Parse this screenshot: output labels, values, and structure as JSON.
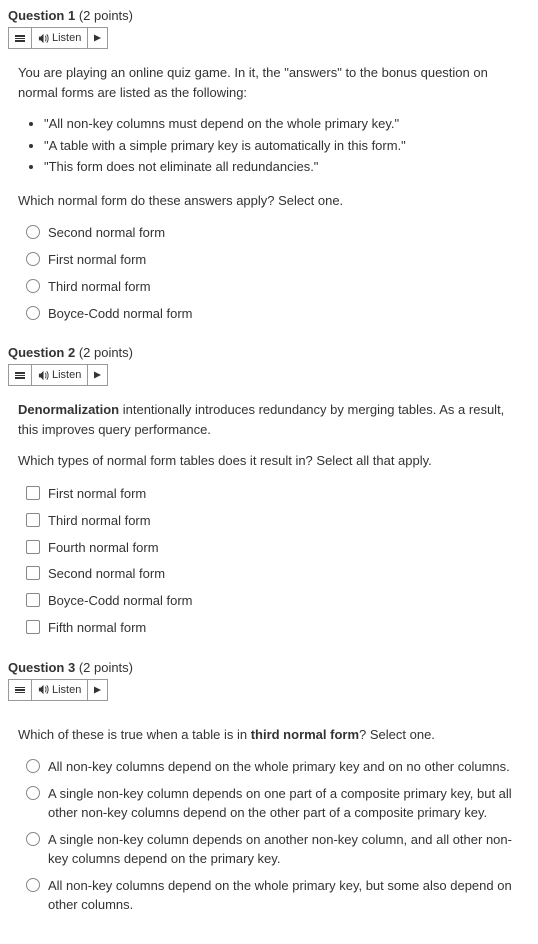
{
  "toolbar": {
    "listen_label": "Listen"
  },
  "questions": [
    {
      "title": "Question 1",
      "points": "(2 points)",
      "intro": "You are playing an online quiz game. In it, the \"answers\" to the bonus question on normal forms are listed as the following:",
      "clues": [
        "\"All non-key columns must depend on the whole primary key.\"",
        "\"A table with a simple primary key is automatically in this form.\"",
        "\"This form does not eliminate all redundancies.\""
      ],
      "prompt": "Which normal form do these answers apply? Select one.",
      "type": "radio",
      "options": [
        "Second normal form",
        "First normal form",
        "Third normal form",
        "Boyce-Codd normal form"
      ]
    },
    {
      "title": "Question 2",
      "points": "(2 points)",
      "intro_bold": "Denormalization",
      "intro_rest": " intentionally introduces redundancy by merging tables. As a result, this improves query performance.",
      "prompt": "Which types of normal form tables does it result in? Select all that apply.",
      "type": "checkbox",
      "options": [
        "First normal form",
        "Third normal form",
        "Fourth normal form",
        "Second normal form",
        "Boyce-Codd normal form",
        "Fifth normal form"
      ]
    },
    {
      "title": "Question 3",
      "points": "(2 points)",
      "prompt_pre": "Which of these is true when a table is in ",
      "prompt_bold": "third normal form",
      "prompt_post": "? Select one.",
      "type": "radio",
      "options": [
        "All non-key columns depend on the whole primary key and on no other columns.",
        "A single non-key column depends on one part of a composite primary key, but all other non-key columns depend on the other part of a composite primary key.",
        "A single non-key column depends on another non-key column, and all other non-key columns depend on the primary key.",
        "All non-key columns depend on the whole primary key, but some also depend on other columns."
      ]
    }
  ]
}
